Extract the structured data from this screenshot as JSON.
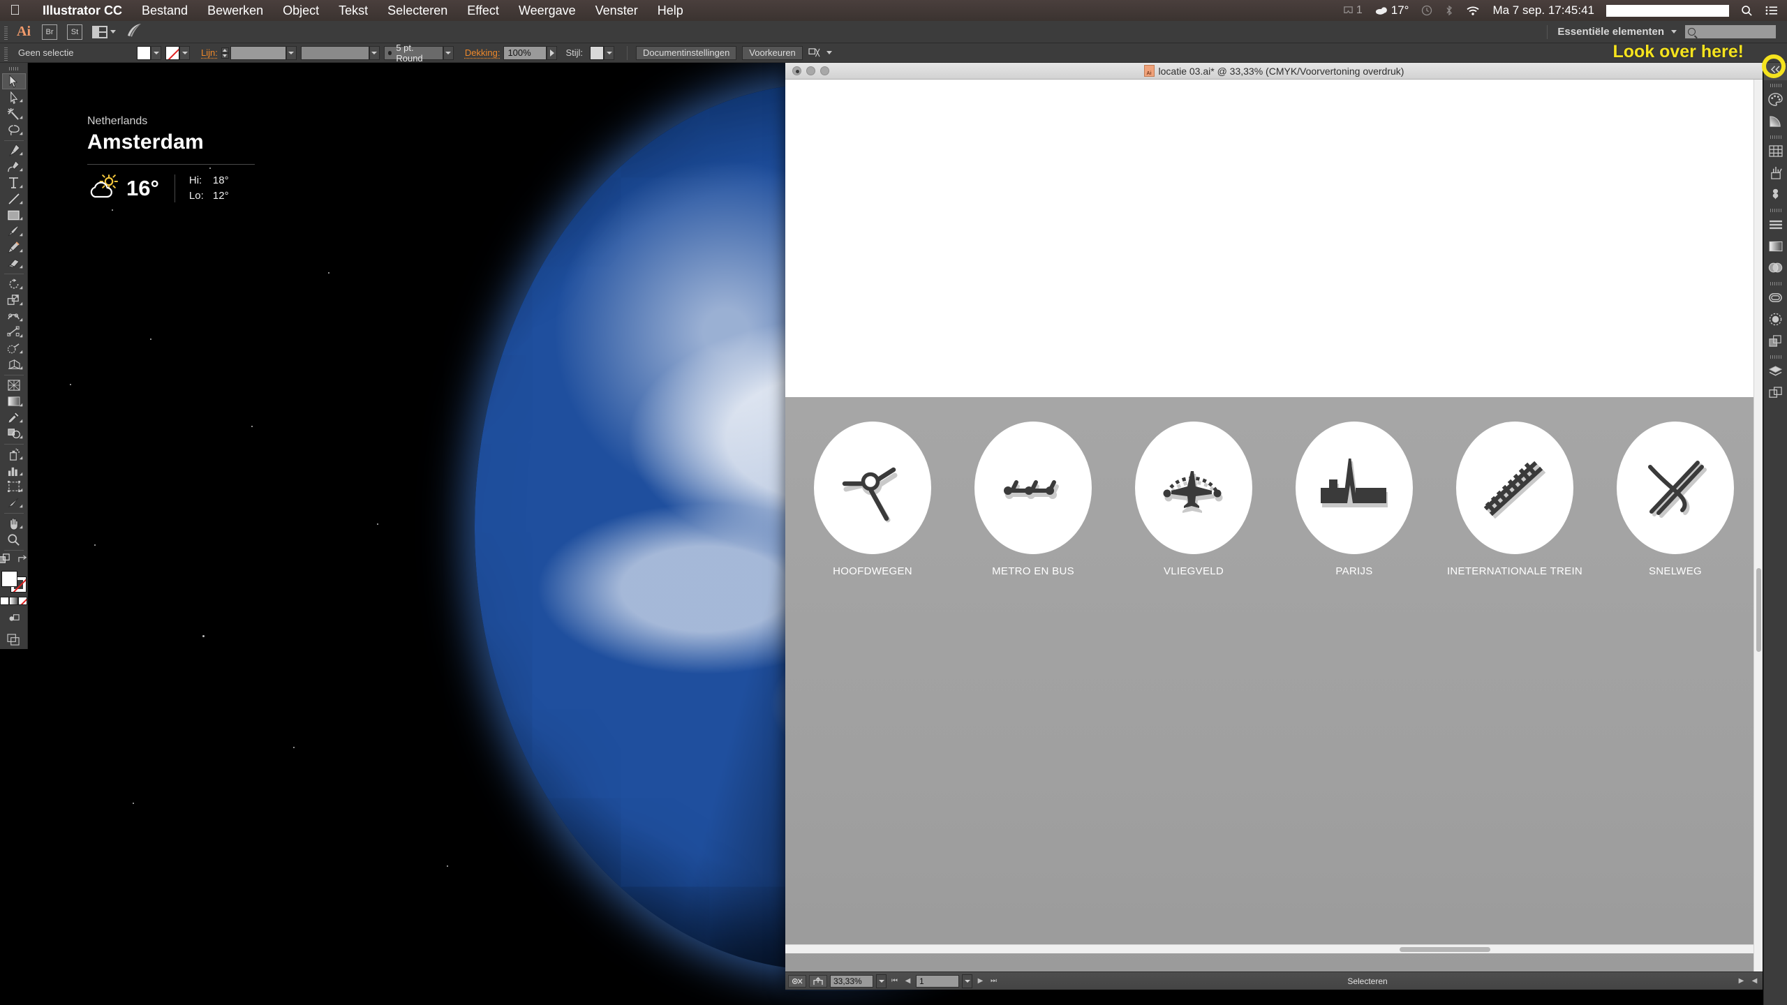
{
  "menubar": {
    "apple_icon": "apple-logo-icon",
    "app_name": "Illustrator CC",
    "items": [
      "Bestand",
      "Bewerken",
      "Object",
      "Tekst",
      "Selecteren",
      "Effect",
      "Weergave",
      "Venster",
      "Help"
    ],
    "status": {
      "airplay_badge": "1",
      "weather_temp": "17°",
      "timemachine_icon": "clock-icon",
      "bluetooth_icon": "bluetooth-icon",
      "wifi_icon": "wifi-icon",
      "datetime": "Ma 7 sep.  17:45:41",
      "spotlight_icon": "search-icon",
      "notification_icon": "list-icon"
    }
  },
  "appbar": {
    "logo": "Ai",
    "bridge_label": "Br",
    "stock_label": "St",
    "arrange_icon": "arrange-documents-icon",
    "feather_icon": "feather-icon",
    "workspace_name": "Essentiële elementen",
    "search_placeholder": ""
  },
  "annotation": {
    "text": "Look over here!",
    "color": "#f5e31e",
    "ring_target": "collapse-panels-button"
  },
  "controlbar": {
    "selection_status": "Geen selectie",
    "fill_swatch": "#ffffff",
    "stroke_swatch": "none",
    "stroke_label": "Lijn:",
    "stroke_weight_value": "",
    "stroke_profile_value": "",
    "brush_label": "5 pt. Round",
    "opacity_label": "Dekking:",
    "opacity_value": "100%",
    "style_label": "Stijl:",
    "style_swatch": "#ffffff",
    "doc_setup_button": "Documentinstellingen",
    "preferences_button": "Voorkeuren"
  },
  "toolbar": {
    "tools": [
      {
        "name": "selection-tool",
        "active": true
      },
      {
        "name": "direct-selection-tool",
        "active": false
      },
      {
        "name": "magic-wand-tool",
        "active": false
      },
      {
        "name": "lasso-tool",
        "active": false
      },
      {
        "name": "pen-tool",
        "active": false
      },
      {
        "name": "curvature-tool",
        "active": false
      },
      {
        "name": "type-tool",
        "active": false
      },
      {
        "name": "line-segment-tool",
        "active": false
      },
      {
        "name": "rectangle-tool",
        "active": false
      },
      {
        "name": "paintbrush-tool",
        "active": false
      },
      {
        "name": "pencil-tool",
        "active": false
      },
      {
        "name": "eraser-tool",
        "active": false
      },
      {
        "name": "rotate-tool",
        "active": false
      },
      {
        "name": "scale-tool",
        "active": false
      },
      {
        "name": "width-tool",
        "active": false
      },
      {
        "name": "free-transform-tool",
        "active": false
      },
      {
        "name": "shape-builder-tool",
        "active": false
      },
      {
        "name": "perspective-grid-tool",
        "active": false
      },
      {
        "name": "mesh-tool",
        "active": false
      },
      {
        "name": "gradient-tool",
        "active": false
      },
      {
        "name": "eyedropper-tool",
        "active": false
      },
      {
        "name": "blend-tool",
        "active": false
      },
      {
        "name": "symbol-sprayer-tool",
        "active": false
      },
      {
        "name": "column-graph-tool",
        "active": false
      },
      {
        "name": "artboard-tool",
        "active": false
      },
      {
        "name": "slice-tool",
        "active": false
      },
      {
        "name": "hand-tool",
        "active": false
      },
      {
        "name": "zoom-tool",
        "active": false
      }
    ],
    "fill_color": "#ffffff",
    "stroke_color": "none"
  },
  "dock": {
    "collapse_icon": "collapse-panels-icon",
    "panels": [
      "color-panel-icon",
      "gradient-panel-icon",
      "swatches-panel-icon",
      "brushes-panel-icon",
      "symbols-panel-icon",
      "align-panel-icon",
      "gradient2-panel-icon",
      "transparency-panel-icon",
      "libraries-panel-icon",
      "appearance-panel-icon",
      "pathfinder-panel-icon",
      "layers-panel-icon",
      "artboards-panel-icon"
    ]
  },
  "desktop": {
    "weather": {
      "country": "Netherlands",
      "city": "Amsterdam",
      "condition_icon": "partly-cloudy-icon",
      "temperature": "16°",
      "hi_key": "Hi:",
      "hi_value": "18°",
      "lo_key": "Lo:",
      "lo_value": "12°"
    }
  },
  "document": {
    "title": "locatie 03.ai* @ 33,33% (CMYK/Voorvertoning overdruk)",
    "file_icon": "illustrator-file-icon",
    "artboard_bg": "#a3a3a3",
    "icons": [
      {
        "label": "HOOFDWEGEN",
        "icon": "roundabout-icon"
      },
      {
        "label": "METRO EN BUS",
        "icon": "metro-bus-line-icon"
      },
      {
        "label": "VLIEGVELD",
        "icon": "airplane-radar-icon"
      },
      {
        "label": "PARIJS",
        "icon": "eiffel-tower-skyline-icon"
      },
      {
        "label": "INETERNATIONALE TREIN",
        "icon": "railway-track-icon"
      },
      {
        "label": "SNELWEG",
        "icon": "highway-interchange-icon"
      }
    ],
    "statusbar": {
      "preview_icon": "preview-mode-icon",
      "share_icon": "share-icon",
      "zoom_value": "33,33%",
      "artboard_value": "1",
      "status_text": "Selecteren",
      "first_icon": "first-artboard-icon",
      "prev_icon": "prev-artboard-icon",
      "next_icon": "next-artboard-icon",
      "last_icon": "last-artboard-icon"
    }
  }
}
